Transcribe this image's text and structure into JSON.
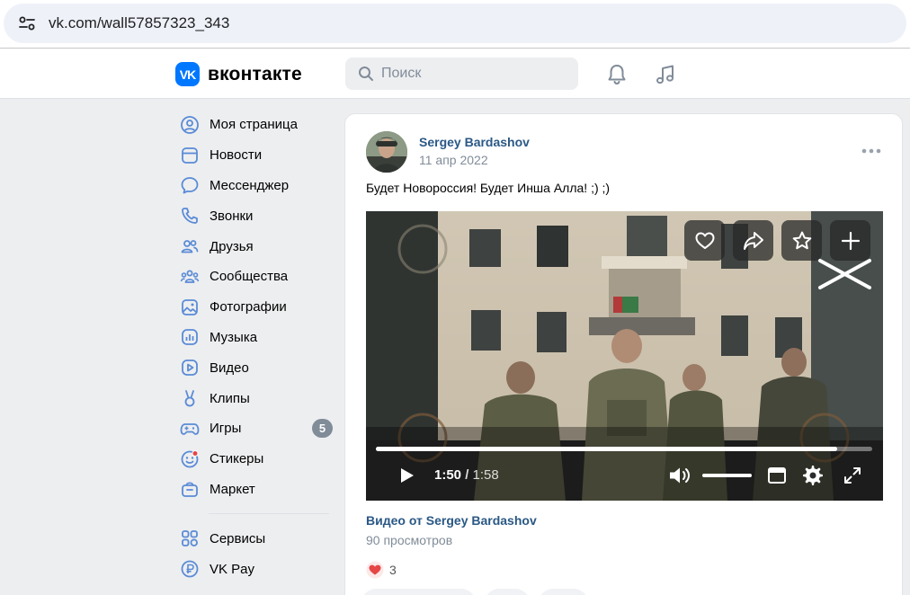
{
  "browser": {
    "url": "vk.com/wall57857323_343"
  },
  "header": {
    "logo_text": "вконтакте",
    "logo_badge": "VK",
    "search_placeholder": "Поиск"
  },
  "sidebar": {
    "items": [
      {
        "label": "Моя страница",
        "icon": "profile-icon"
      },
      {
        "label": "Новости",
        "icon": "news-icon"
      },
      {
        "label": "Мессенджер",
        "icon": "messenger-icon"
      },
      {
        "label": "Звонки",
        "icon": "phone-icon"
      },
      {
        "label": "Друзья",
        "icon": "friends-icon"
      },
      {
        "label": "Сообщества",
        "icon": "communities-icon"
      },
      {
        "label": "Фотографии",
        "icon": "photos-icon"
      },
      {
        "label": "Музыка",
        "icon": "music-icon"
      },
      {
        "label": "Видео",
        "icon": "video-icon"
      },
      {
        "label": "Клипы",
        "icon": "clips-icon"
      },
      {
        "label": "Игры",
        "icon": "games-icon",
        "badge": "5"
      },
      {
        "label": "Стикеры",
        "icon": "stickers-icon"
      },
      {
        "label": "Маркет",
        "icon": "market-icon"
      }
    ],
    "secondary": [
      {
        "label": "Сервисы",
        "icon": "services-icon"
      },
      {
        "label": "VK Pay",
        "icon": "vkpay-icon"
      }
    ]
  },
  "post": {
    "author": "Sergey Bardashov",
    "date": "11 апр 2022",
    "text": "Будет Новороссия! Будет Инша Алла! ;) ;)",
    "video": {
      "current_time": "1:50",
      "separator": "/",
      "duration": "1:58",
      "progress": 0.93,
      "title": "Видео от Sergey Bardashov",
      "views": "90 просмотров"
    },
    "likes": "3"
  },
  "colors": {
    "accent": "#0077ff",
    "link": "#2a5885",
    "secondary_text": "#818c99",
    "like": "#e64646"
  }
}
